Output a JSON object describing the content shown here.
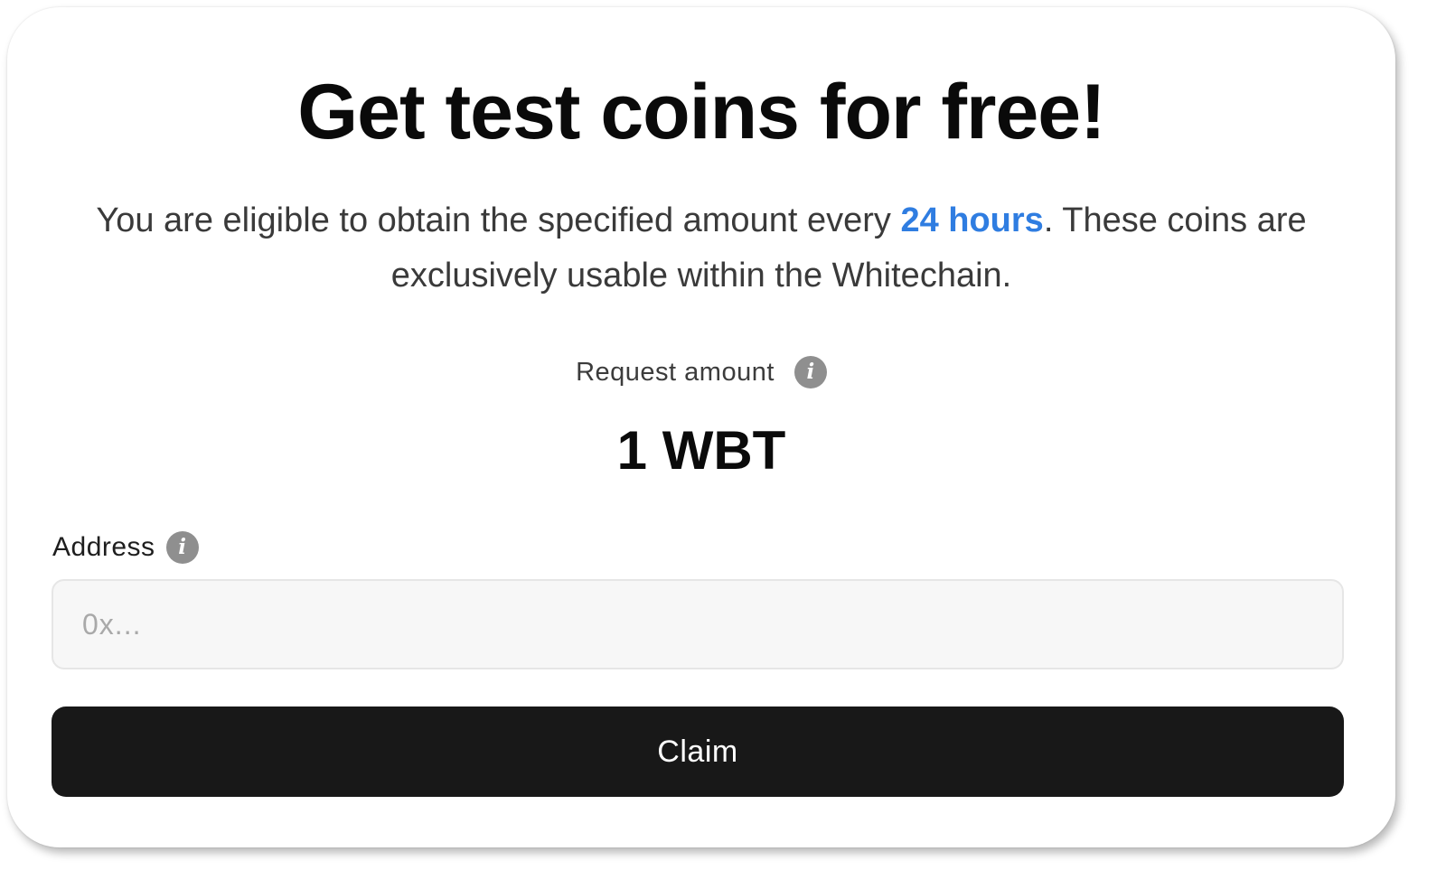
{
  "header": {
    "title": "Get test coins for free!",
    "description_prefix": "You are eligible to obtain the specified amount every ",
    "description_highlight": "24 hours",
    "description_suffix": ". These coins are exclusively usable within the Whitechain."
  },
  "request": {
    "label": "Request amount",
    "info_icon": "info-icon",
    "amount": "1 WBT"
  },
  "address": {
    "label": "Address",
    "info_icon": "info-icon",
    "value": "",
    "placeholder": "0x..."
  },
  "actions": {
    "claim_label": "Claim"
  },
  "colors": {
    "highlight": "#2f7de1",
    "button_background": "#181818",
    "info_icon": "#8f8f8f"
  }
}
